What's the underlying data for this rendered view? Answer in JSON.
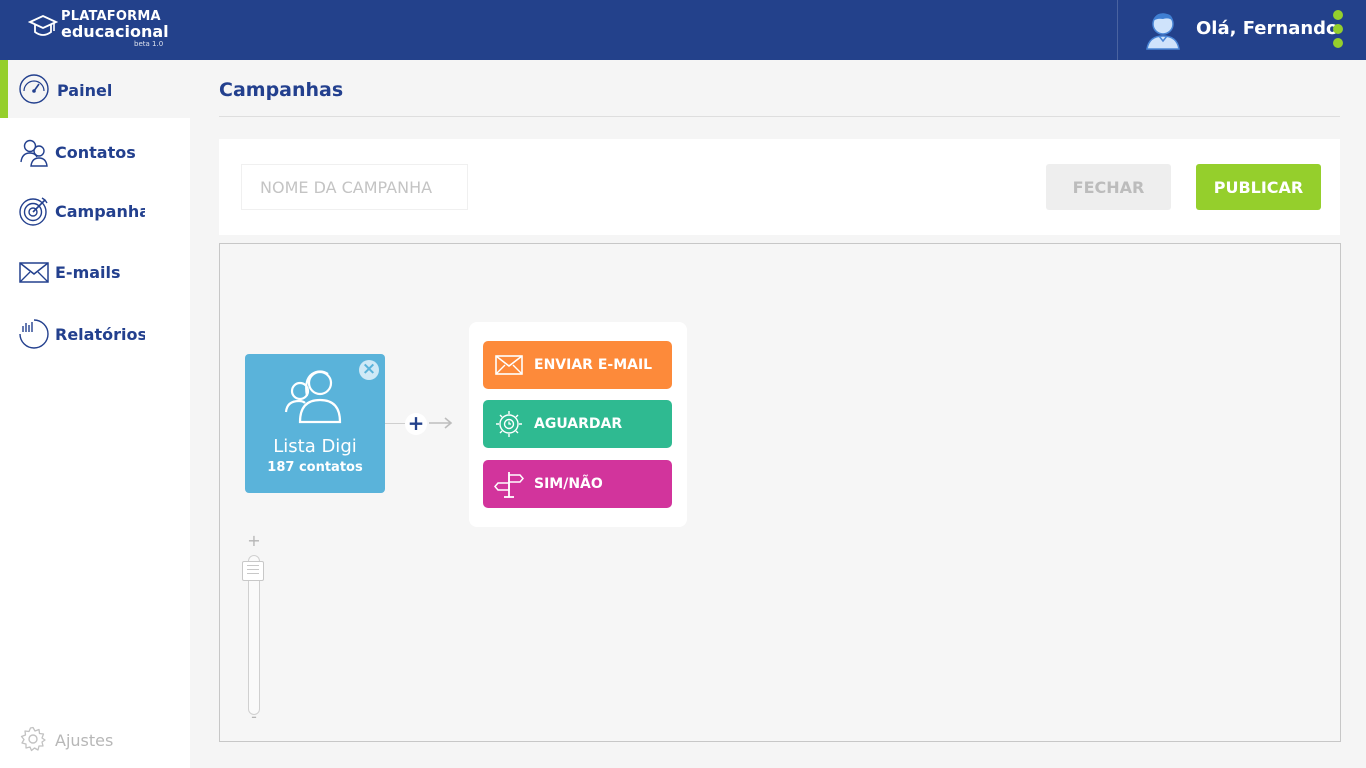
{
  "app": {
    "logo_line1": "PLATAFORMA",
    "logo_line2": "educacional",
    "logo_version": "beta 1.0",
    "greeting": "Olá, Fernando"
  },
  "sidebar": {
    "items": [
      {
        "label": "Painel",
        "icon": "speedometer-icon",
        "active": true
      },
      {
        "label": "Contatos",
        "icon": "contacts-icon",
        "active": false
      },
      {
        "label": "Campanhas",
        "icon": "target-icon",
        "active": false
      },
      {
        "label": "E-mails",
        "icon": "envelope-icon",
        "active": false
      },
      {
        "label": "Relatórios",
        "icon": "report-chart-icon",
        "active": false
      }
    ],
    "settings_label": "Ajustes"
  },
  "page": {
    "title": "Campanhas"
  },
  "toolbar": {
    "name_placeholder": "NOME DA CAMPANHA",
    "close_label": "FECHAR",
    "publish_label": "PUBLICAR"
  },
  "canvas": {
    "list_node": {
      "name": "Lista Digi",
      "count": "187 contatos"
    },
    "add_step_symbol": "+",
    "actions": [
      {
        "label": "ENVIAR E-MAIL",
        "icon": "envelope-icon",
        "color": "#fd8a3a"
      },
      {
        "label": "AGUARDAR",
        "icon": "clock-gear-icon",
        "color": "#2fba91"
      },
      {
        "label": "SIM/NÃO",
        "icon": "signpost-icon",
        "color": "#d2349c"
      }
    ],
    "zoom": {
      "in_symbol": "+",
      "out_symbol": "-"
    }
  },
  "colors": {
    "header": "#23418b",
    "accent": "#95cf2c",
    "list_node": "#5ab3da"
  }
}
